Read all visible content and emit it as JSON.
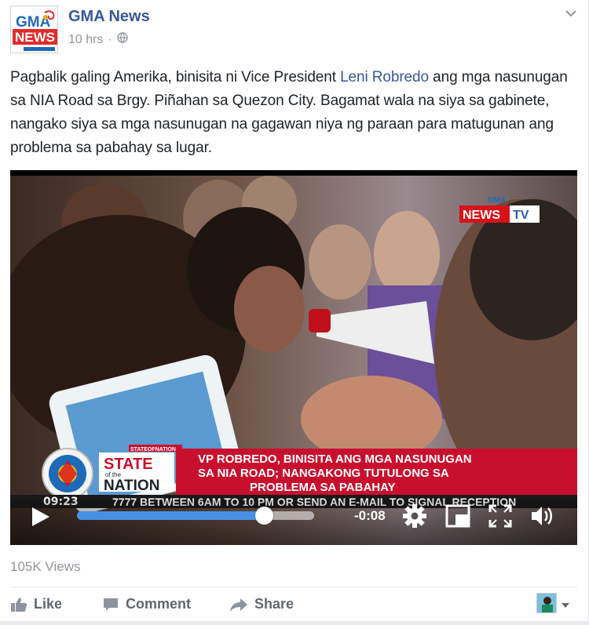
{
  "page": {
    "name": "GMA News",
    "time": "10 hrs",
    "privacy_icon": "globe-icon",
    "logo_top": "GMA",
    "logo_bottom": "NEWS"
  },
  "post": {
    "text_before": "Pagbalik galing Amerika, binisita ni Vice President ",
    "mention": "Leni Robredo",
    "text_after": " ang mga nasunugan sa NIA Road sa Brgy. Piñahan sa Quezon City. Bagamat wala na siya sa gabinete, nangako siya sa mga nasunugan na gagawan niya ng paraan para matugunan ang problema sa pabahay sa lugar."
  },
  "video": {
    "channel_bug": "NEWS",
    "channel_bug_suffix": "TV",
    "channel_bug_small": "GMA",
    "show_hashtag": "STATEOFNATION",
    "show_name_top": "STATE",
    "show_name_mid": "of the",
    "show_name_bottom": "NATION",
    "headline_line1": "VP ROBREDO, BINISITA ANG MGA NASUNUGAN",
    "headline_line2": "SA NIA ROAD; NANGAKONG TUTULONG SA",
    "headline_line3": "PROBLEMA SA PABAHAY",
    "ticker_time": "09:23",
    "ticker_text": "7777 BETWEEN 6AM TO 10 PM OR SEND AN E-MAIL TO SIGNAL RECEPTION",
    "time_remaining": "-0:08",
    "progress": 0.79,
    "accent_color": "#4a90e2"
  },
  "stats": {
    "views": "105K Views"
  },
  "actions": {
    "like": "Like",
    "comment": "Comment",
    "share": "Share"
  }
}
